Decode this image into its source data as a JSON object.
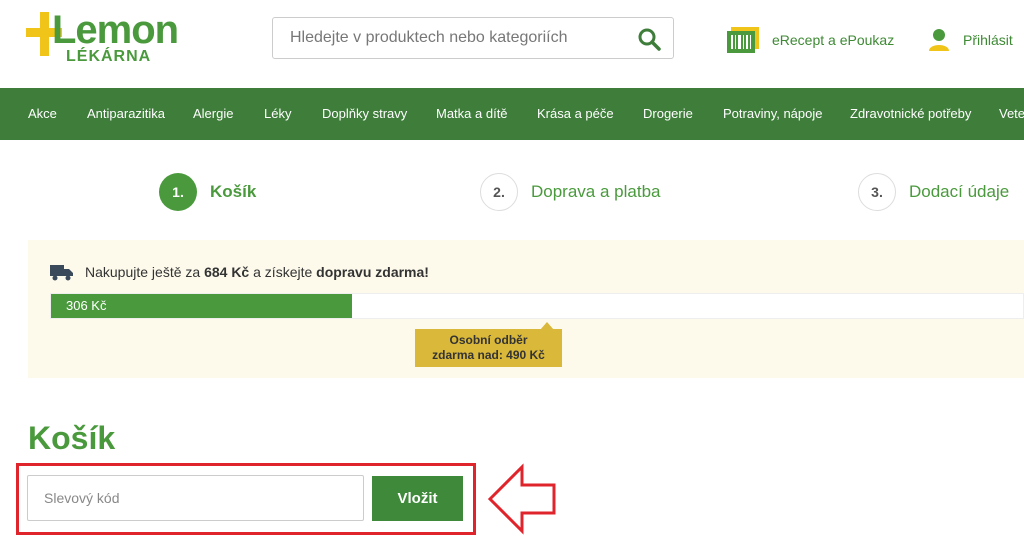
{
  "header": {
    "logo": {
      "word": "Lemon",
      "sub": "LÉKÁRNA"
    },
    "search": {
      "placeholder": "Hledejte v produktech nebo kategoriích"
    },
    "erecept_label": "eRecept a ePoukaz",
    "login_label": "Přihlásit"
  },
  "nav": {
    "items": [
      "Akce",
      "Antiparazitika",
      "Alergie",
      "Léky",
      "Doplňky stravy",
      "Matka a dítě",
      "Krása a péče",
      "Drogerie",
      "Potraviny, nápoje",
      "Zdravotnické potřeby",
      "Vete"
    ]
  },
  "steps": [
    {
      "number": "1.",
      "label": "Košík",
      "active": true
    },
    {
      "number": "2.",
      "label": "Doprava a platba",
      "active": false
    },
    {
      "number": "3.",
      "label": "Dodací údaje",
      "active": false
    }
  ],
  "shipping": {
    "text_prefix": "Nakupujte ještě za",
    "remaining": "684 Kč",
    "text_middle": "a získejte",
    "free_shipping": "dopravu zdarma!",
    "progress_value_label": "306 Kč",
    "progress_fraction": 0.31,
    "tooltip_line1": "Osobní odběr",
    "tooltip_line2": "zdarma nad: 490 Kč"
  },
  "cart": {
    "title": "Košík",
    "coupon_placeholder": "Slevový kód",
    "coupon_button": "Vložit"
  },
  "colors": {
    "brand_green": "#4a9a3d",
    "nav_green": "#3e7d3a",
    "lemon_yellow": "#f0c419",
    "tooltip_yellow": "#d9b83a",
    "highlight_red": "#e0242b",
    "info_bg": "#fdfaec"
  }
}
